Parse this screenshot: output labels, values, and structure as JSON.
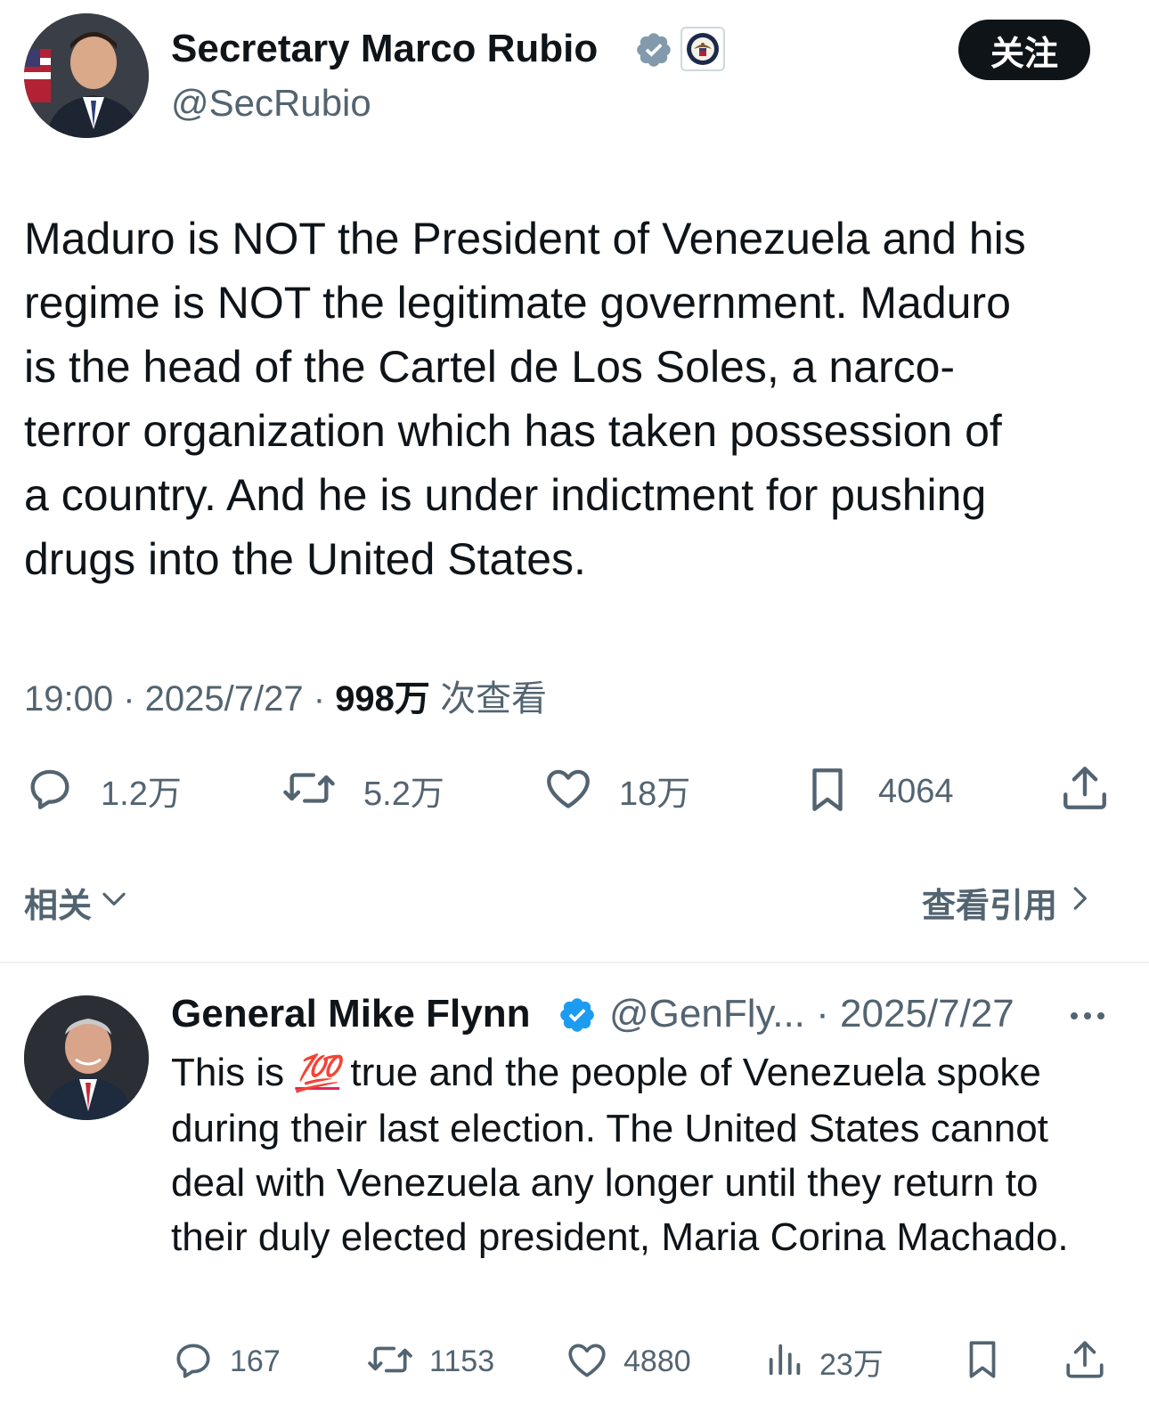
{
  "tweet": {
    "author_name": "Secretary Marco Rubio",
    "author_handle": "@SecRubio",
    "follow_label": "关注",
    "text": "Maduro is NOT the President of Venezuela and his\nregime is NOT the legitimate government.  Maduro\nis the head of the Cartel de Los Soles, a narco-\nterror organization which has taken possession of\na country.  And he is under indictment for pushing\ndrugs into the United States.",
    "time": "19:00",
    "date": "2025/7/27",
    "views_count": "998万",
    "views_label": "次查看",
    "replies": "1.2万",
    "reposts": "5.2万",
    "likes": "18万",
    "bookmarks": "4064",
    "related_label": "相关",
    "quotes_label": "查看引用"
  },
  "reply": {
    "author_name": "General Mike Flynn",
    "author_handle": "@GenFly...",
    "date": "2025/7/27",
    "text_before": "This is ",
    "emoji": "💯",
    "text_after": " true and the people of Venezuela spoke during their last election. The United States cannot deal with Venezuela any longer until they return to their duly elected president, Maria Corina Machado.",
    "replies": "167",
    "reposts": "1153",
    "likes": "4880",
    "views": "23万"
  },
  "colors": {
    "text": "#0f1419",
    "secondary": "#536471",
    "verified_gray": "#829aab",
    "verified_blue": "#1d9bf0",
    "divider": "#eff3f4"
  },
  "icons": [
    "verified-badge-icon",
    "state-dept-seal-icon",
    "reply-icon",
    "repost-icon",
    "like-icon",
    "bookmark-icon",
    "share-icon",
    "views-icon",
    "more-icon",
    "chevron-down-icon",
    "chevron-right-icon"
  ]
}
